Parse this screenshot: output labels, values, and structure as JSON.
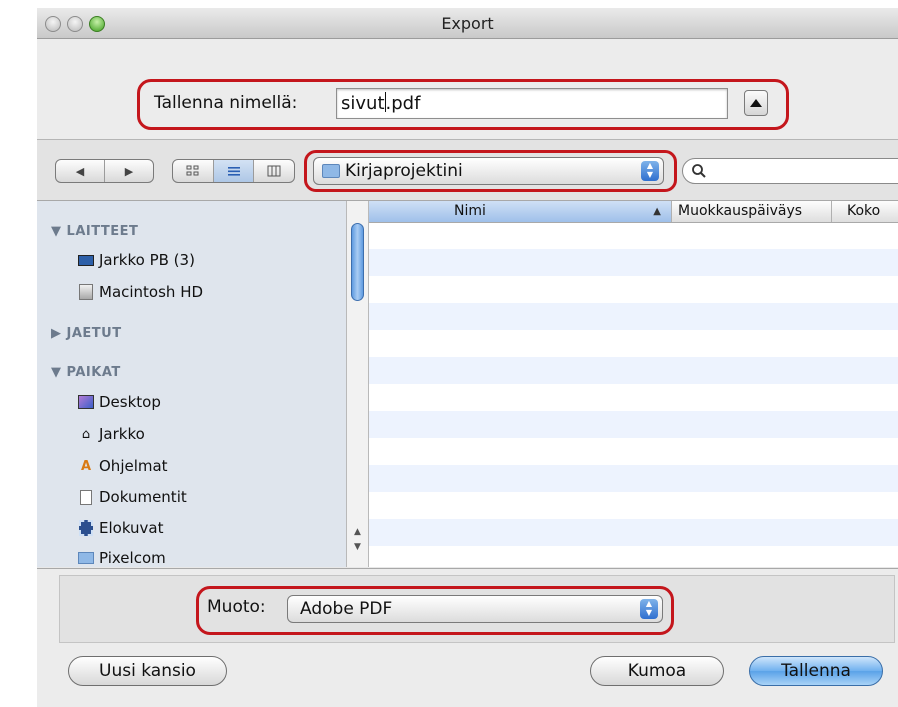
{
  "window": {
    "title": "Export"
  },
  "save": {
    "label": "Tallenna nimellä:",
    "filename_before_cursor": "sivut",
    "filename_after_cursor": ".pdf"
  },
  "toolbar": {
    "back_glyph": "◀",
    "forward_glyph": "▶",
    "view_icons": [
      "icon-view-icon",
      "list-view-icon",
      "column-view-icon"
    ],
    "location": "Kirjaprojektini",
    "search_placeholder": ""
  },
  "sidebar": {
    "sections": [
      {
        "heading": "LAITTEET",
        "expanded": true,
        "items": [
          {
            "label": "Jarkko PB (3)",
            "icon": "laptop-icon"
          },
          {
            "label": "Macintosh HD",
            "icon": "hard-drive-icon"
          }
        ]
      },
      {
        "heading": "JAETUT",
        "expanded": false,
        "items": []
      },
      {
        "heading": "PAIKAT",
        "expanded": true,
        "items": [
          {
            "label": "Desktop",
            "icon": "desktop-icon"
          },
          {
            "label": "Jarkko",
            "icon": "home-icon"
          },
          {
            "label": "Ohjelmat",
            "icon": "applications-icon"
          },
          {
            "label": "Dokumentit",
            "icon": "documents-icon"
          },
          {
            "label": "Elokuvat",
            "icon": "movies-icon"
          },
          {
            "label": "Pixelcom",
            "icon": "folder-icon"
          }
        ]
      }
    ]
  },
  "file_list": {
    "columns": [
      "Nimi",
      "Muokkauspäiväys",
      "Koko"
    ],
    "sort_indicator": "▲"
  },
  "format": {
    "label": "Muoto:",
    "value": "Adobe PDF"
  },
  "buttons": {
    "new_folder": "Uusi kansio",
    "cancel": "Kumoa",
    "save": "Tallenna"
  },
  "colors": {
    "highlight": "#c4161c",
    "accent": "#5aa2e8",
    "sidebar_bg": "#dfe5ed",
    "stripe": "#edf3fe"
  }
}
